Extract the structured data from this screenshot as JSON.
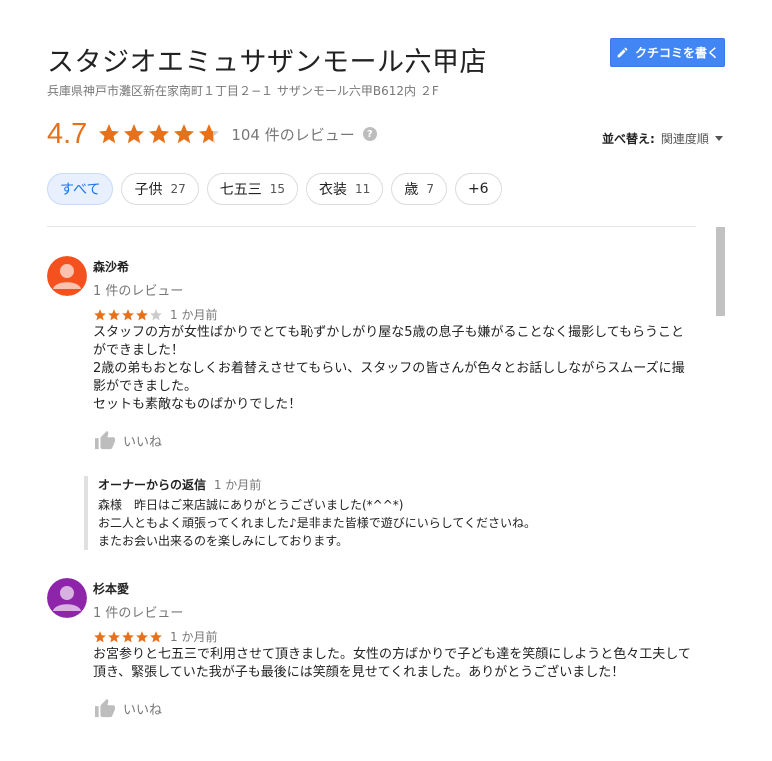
{
  "place": {
    "title": "スタジオエミュサザンモール六甲店",
    "address": "兵庫県神戸市灘区新在家南町１丁目２−１ サザンモール六甲B612内 ２F",
    "write_review_label": "クチコミを書く"
  },
  "rating": {
    "value": "4.7",
    "stars": 4.7,
    "review_count_label": "104 件のレビュー",
    "help_icon": "?"
  },
  "sort": {
    "label": "並べ替え:",
    "value": "関連度順"
  },
  "filters": [
    {
      "label": "すべて",
      "count": ""
    },
    {
      "label": "子供",
      "count": "27"
    },
    {
      "label": "七五三",
      "count": "15"
    },
    {
      "label": "衣装",
      "count": "11"
    },
    {
      "label": "歳",
      "count": "7"
    },
    {
      "label": "+6",
      "count": ""
    }
  ],
  "reviews": [
    {
      "name": "森沙希",
      "meta": "1 件のレビュー",
      "stars": 4,
      "time": "1 か月前",
      "avatar_color": "#f4511e",
      "lines": [
        "スタッフの方が女性ばかりでとても恥ずかしがり屋な5歳の息子も嫌がることなく撮影してもらうこと",
        "ができました！",
        "2歳の弟もおとなしくお着替えさせてもらい、スタッフの皆さんが色々とお話ししながらスムーズに撮",
        "影ができました。",
        "セットも素敵なものばかりでした！"
      ],
      "like_label": "いいね",
      "owner_reply": {
        "label": "オーナーからの返信",
        "time": "1 か月前",
        "lines": [
          "森様　昨日はご来店誠にありがとうございました(*^^*)",
          "お二人ともよく頑張ってくれました♪是非また皆様で遊びにいらしてくださいね。",
          "またお会い出来るのを楽しみにしております。"
        ]
      }
    },
    {
      "name": "杉本愛",
      "meta": "1 件のレビュー",
      "stars": 5,
      "time": "1 か月前",
      "avatar_color": "#8e24aa",
      "lines": [
        "お宮参りと七五三で利用させて頂きました。女性の方ばかりで子ども達を笑顔にしようと色々工夫して",
        "頂き、緊張していた我が子も最後には笑顔を見せてくれました。ありがとうございました！"
      ],
      "like_label": "いいね"
    }
  ],
  "colors": {
    "star": "#e7711b",
    "star_empty": "#cccccc",
    "accent": "#4285f4"
  }
}
